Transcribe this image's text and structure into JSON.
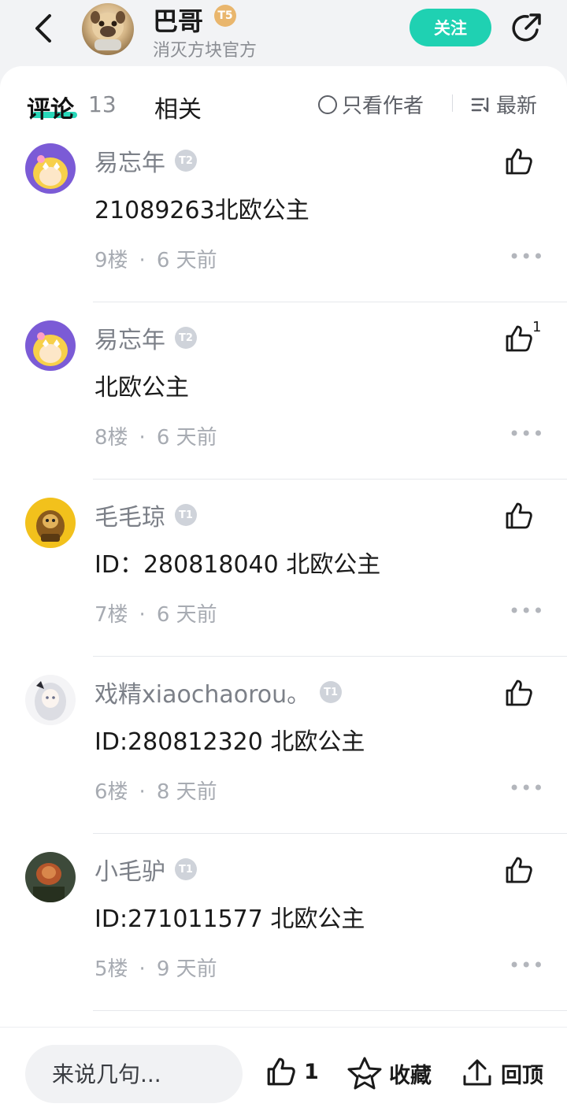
{
  "header": {
    "author_name": "巴哥",
    "author_level": "T5",
    "author_subtitle": "消灭方块官方",
    "follow_label": "关注"
  },
  "tabs": {
    "comments_label": "评论",
    "comments_count": "13",
    "related_label": "相关",
    "author_only_label": "只看作者",
    "sort_label": "最新"
  },
  "comments": [
    {
      "name": "易忘年",
      "level": "T2",
      "text": "21089263北欧公主",
      "floor": "9楼",
      "time": "6 天前",
      "likes": ""
    },
    {
      "name": "易忘年",
      "level": "T2",
      "text": "北欧公主",
      "floor": "8楼",
      "time": "6 天前",
      "likes": "1"
    },
    {
      "name": "毛毛琼",
      "level": "T1",
      "text": "ID：280818040 北欧公主",
      "floor": "7楼",
      "time": "6 天前",
      "likes": ""
    },
    {
      "name": "戏精xiaochaorou。",
      "level": "T1",
      "text": "ID:280812320  北欧公主",
      "floor": "6楼",
      "time": "8 天前",
      "likes": ""
    },
    {
      "name": "小毛驴",
      "level": "T1",
      "text": "ID:271011577 北欧公主",
      "floor": "5楼",
      "time": "9 天前",
      "likes": ""
    }
  ],
  "bottom": {
    "reply_placeholder": "来说几句...",
    "like_count": "1",
    "favorite_label": "收藏",
    "top_label": "回顶"
  },
  "colors": {
    "accent": "#1fd1b2",
    "tab_underline": "#28d7b9",
    "badge_gold": "#e9b66d",
    "badge_gray": "#cfd3da"
  }
}
